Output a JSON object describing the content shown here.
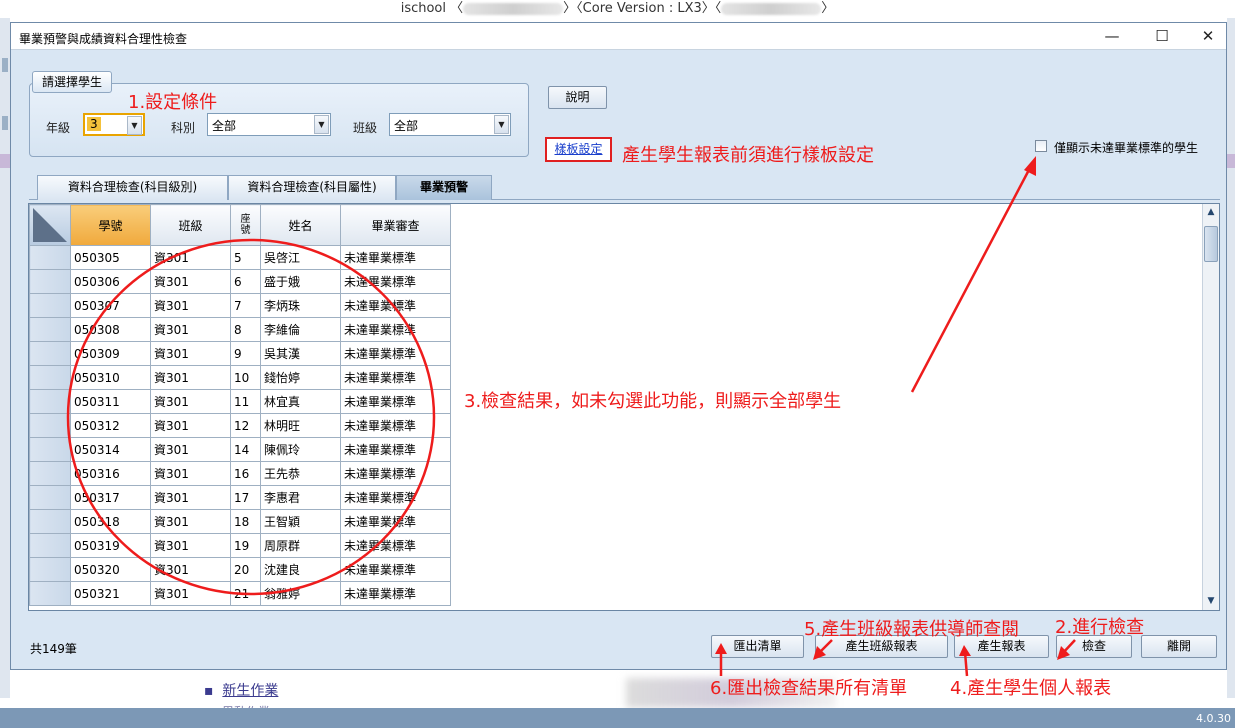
{
  "background": {
    "title_prefix": "ischool",
    "title_core": "Core Version : LX3",
    "bottom_link": "新生作業",
    "bottom_link2": "異動作業",
    "version": "4.0.30"
  },
  "window": {
    "title": "畢業預警與成績資料合理性檢查",
    "controls": {
      "minimize": "—",
      "maximize": "☐",
      "close": "✕"
    }
  },
  "filter": {
    "group_label": "請選擇學生",
    "grade_label": "年級",
    "grade_value": "3",
    "dept_label": "科別",
    "dept_value": "全部",
    "class_label": "班級",
    "class_value": "全部"
  },
  "buttons": {
    "help": "說明",
    "template": "樣板設定",
    "export": "匯出清單",
    "class_report": "產生班級報表",
    "report": "產生報表",
    "check": "檢查",
    "leave": "離開"
  },
  "option": {
    "only_failed_label": "僅顯示未達畢業標準的學生",
    "only_failed_checked": false
  },
  "tabs": [
    "資料合理檢查(科目級別)",
    "資料合理檢查(科目屬性)",
    "畢業預警"
  ],
  "selected_tab": "畢業預警",
  "grid": {
    "columns": [
      "學號",
      "班級",
      "座號",
      "姓名",
      "畢業審查"
    ],
    "rows": [
      [
        "050305",
        "資301",
        "5",
        "吳啓江",
        "未達畢業標準"
      ],
      [
        "050306",
        "資301",
        "6",
        "盛于娥",
        "未達畢業標準"
      ],
      [
        "050307",
        "資301",
        "7",
        "李炳珠",
        "未達畢業標準"
      ],
      [
        "050308",
        "資301",
        "8",
        "李維倫",
        "未達畢業標準"
      ],
      [
        "050309",
        "資301",
        "9",
        "吳其漢",
        "未達畢業標準"
      ],
      [
        "050310",
        "資301",
        "10",
        "錢怡婷",
        "未達畢業標準"
      ],
      [
        "050311",
        "資301",
        "11",
        "林宜真",
        "未達畢業標準"
      ],
      [
        "050312",
        "資301",
        "12",
        "林明旺",
        "未達畢業標準"
      ],
      [
        "050314",
        "資301",
        "14",
        "陳佩玲",
        "未達畢業標準"
      ],
      [
        "050316",
        "資301",
        "16",
        "王先恭",
        "未達畢業標準"
      ],
      [
        "050317",
        "資301",
        "17",
        "李惠君",
        "未達畢業標準"
      ],
      [
        "050318",
        "資301",
        "18",
        "王智穎",
        "未達畢業標準"
      ],
      [
        "050319",
        "資301",
        "19",
        "周原群",
        "未達畢業標準"
      ],
      [
        "050320",
        "資301",
        "20",
        "沈建良",
        "未達畢業標準"
      ],
      [
        "050321",
        "資301",
        "21",
        "翁雅婷",
        "未達畢業標準"
      ]
    ]
  },
  "status": {
    "total": "共149筆"
  },
  "annotations": {
    "step1": "1.設定條件",
    "template_note": "產生學生報表前須進行樣板設定",
    "step3": "3.檢查結果，如未勾選此功能，則顯示全部學生",
    "step5": "5.產生班級報表供導師查閱",
    "step2": "2.進行檢查",
    "step6": "6.匯出檢查結果所有清單",
    "step4": "4.產生學生個人報表"
  },
  "colors": {
    "annotation": "#ee1c1c",
    "sorted_header": "#f0a93c",
    "window_bg": "#d9e6f3"
  }
}
